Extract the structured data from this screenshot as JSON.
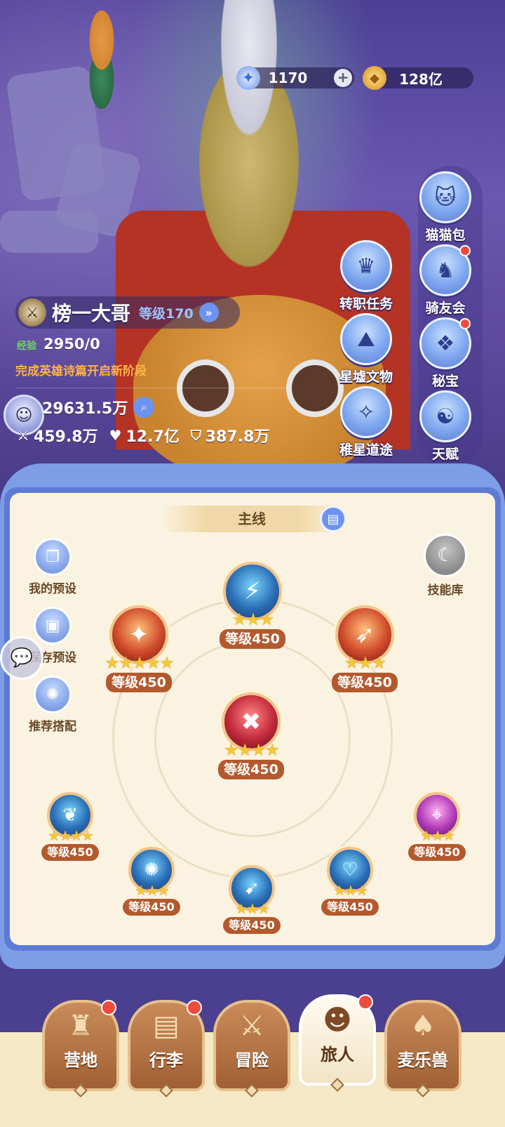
{
  "currencies": {
    "stars": "1170",
    "stars_plus": "+",
    "gold": "128亿"
  },
  "player": {
    "name": "榜一大哥",
    "level": "等级170",
    "exp_label": "经验",
    "exp_value": "2950/0",
    "quest_hint": "完成英雄诗篇开启新阶段",
    "power": "29631.5万",
    "stats": {
      "attack": "459.8万",
      "hp": "12.7亿",
      "defense": "387.8万"
    }
  },
  "center_buttons": [
    {
      "label": "转职任务",
      "icon": "crown-icon"
    },
    {
      "label": "星墟文物",
      "icon": "mountain-icon"
    },
    {
      "label": "稚星道途",
      "icon": "star-path-icon"
    }
  ],
  "right_buttons": [
    {
      "label": "猫猫包",
      "icon": "cat-bag-icon",
      "badge": false
    },
    {
      "label": "骑友会",
      "icon": "horse-icon",
      "badge": true
    },
    {
      "label": "秘宝",
      "icon": "treasure-icon",
      "badge": true
    },
    {
      "label": "天赋",
      "icon": "talent-icon",
      "badge": false
    }
  ],
  "skill_board": {
    "tab": "主线",
    "side_buttons": [
      "我的预设",
      "保存预设",
      "推荐搭配"
    ],
    "library": "技能库",
    "skills": [
      {
        "id": "top",
        "level": "等级450",
        "stars": 3
      },
      {
        "id": "left",
        "level": "等级450",
        "stars": 5
      },
      {
        "id": "right",
        "level": "等级450",
        "stars": 3
      },
      {
        "id": "center",
        "level": "等级450",
        "stars": 4
      },
      {
        "id": "row2-1",
        "level": "等级450",
        "stars": 4
      },
      {
        "id": "row2-2",
        "level": "等级450",
        "stars": 3
      },
      {
        "id": "row2-3",
        "level": "等级450",
        "stars": 3
      },
      {
        "id": "row2-4",
        "level": "等级450",
        "stars": 3
      },
      {
        "id": "row2-5",
        "level": "等级450",
        "stars": 3
      }
    ]
  },
  "bottom_nav": [
    {
      "label": "营地",
      "badge": true,
      "active": false
    },
    {
      "label": "行李",
      "badge": true,
      "active": false
    },
    {
      "label": "冒险",
      "badge": false,
      "active": false
    },
    {
      "label": "旅人",
      "badge": true,
      "active": true
    },
    {
      "label": "麦乐兽",
      "badge": false,
      "active": false
    }
  ],
  "colors": {
    "level_text": "#9fc2ff",
    "quest_hint": "#ffb248",
    "exp_label": "#6fd463",
    "badge": "#ef4b3f",
    "skill_level_bg": "#b4592e"
  }
}
